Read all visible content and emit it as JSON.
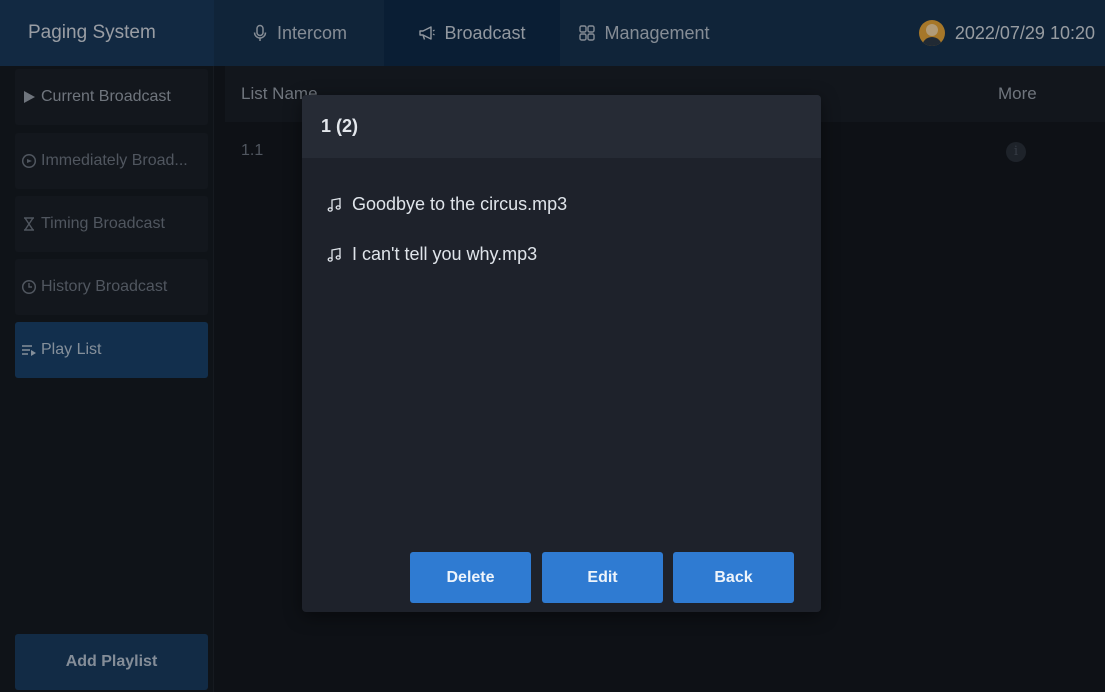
{
  "app": {
    "title": "Paging System"
  },
  "nav": {
    "tabs": [
      {
        "label": "Intercom",
        "icon": "microphone-icon"
      },
      {
        "label": "Broadcast",
        "icon": "megaphone-icon"
      },
      {
        "label": "Management",
        "icon": "grid-icon"
      }
    ],
    "datetime": "2022/07/29 10:20"
  },
  "sidebar": {
    "items": [
      {
        "label": "Current Broadcast",
        "icon": "play-icon"
      },
      {
        "label": "Immediately Broad...",
        "icon": "broadcast-icon"
      },
      {
        "label": "Timing Broadcast",
        "icon": "hourglass-icon"
      },
      {
        "label": "History Broadcast",
        "icon": "clock-icon"
      },
      {
        "label": "Play List",
        "icon": "playlist-icon",
        "active": true
      }
    ],
    "add_label": "Add Playlist"
  },
  "table": {
    "headers": {
      "name": "List Name",
      "more": "More"
    },
    "rows": [
      {
        "name": "1.1"
      }
    ]
  },
  "dialog": {
    "title": "1 (2)",
    "tracks": [
      "Goodbye to the circus.mp3",
      "I can't tell you why.mp3"
    ],
    "buttons": {
      "delete": "Delete",
      "edit": "Edit",
      "back": "Back"
    }
  },
  "colors": {
    "topbar": "#17324f",
    "accent": "#2f7bd2",
    "active_sidebar": "#19426b",
    "background": "#14181f"
  }
}
